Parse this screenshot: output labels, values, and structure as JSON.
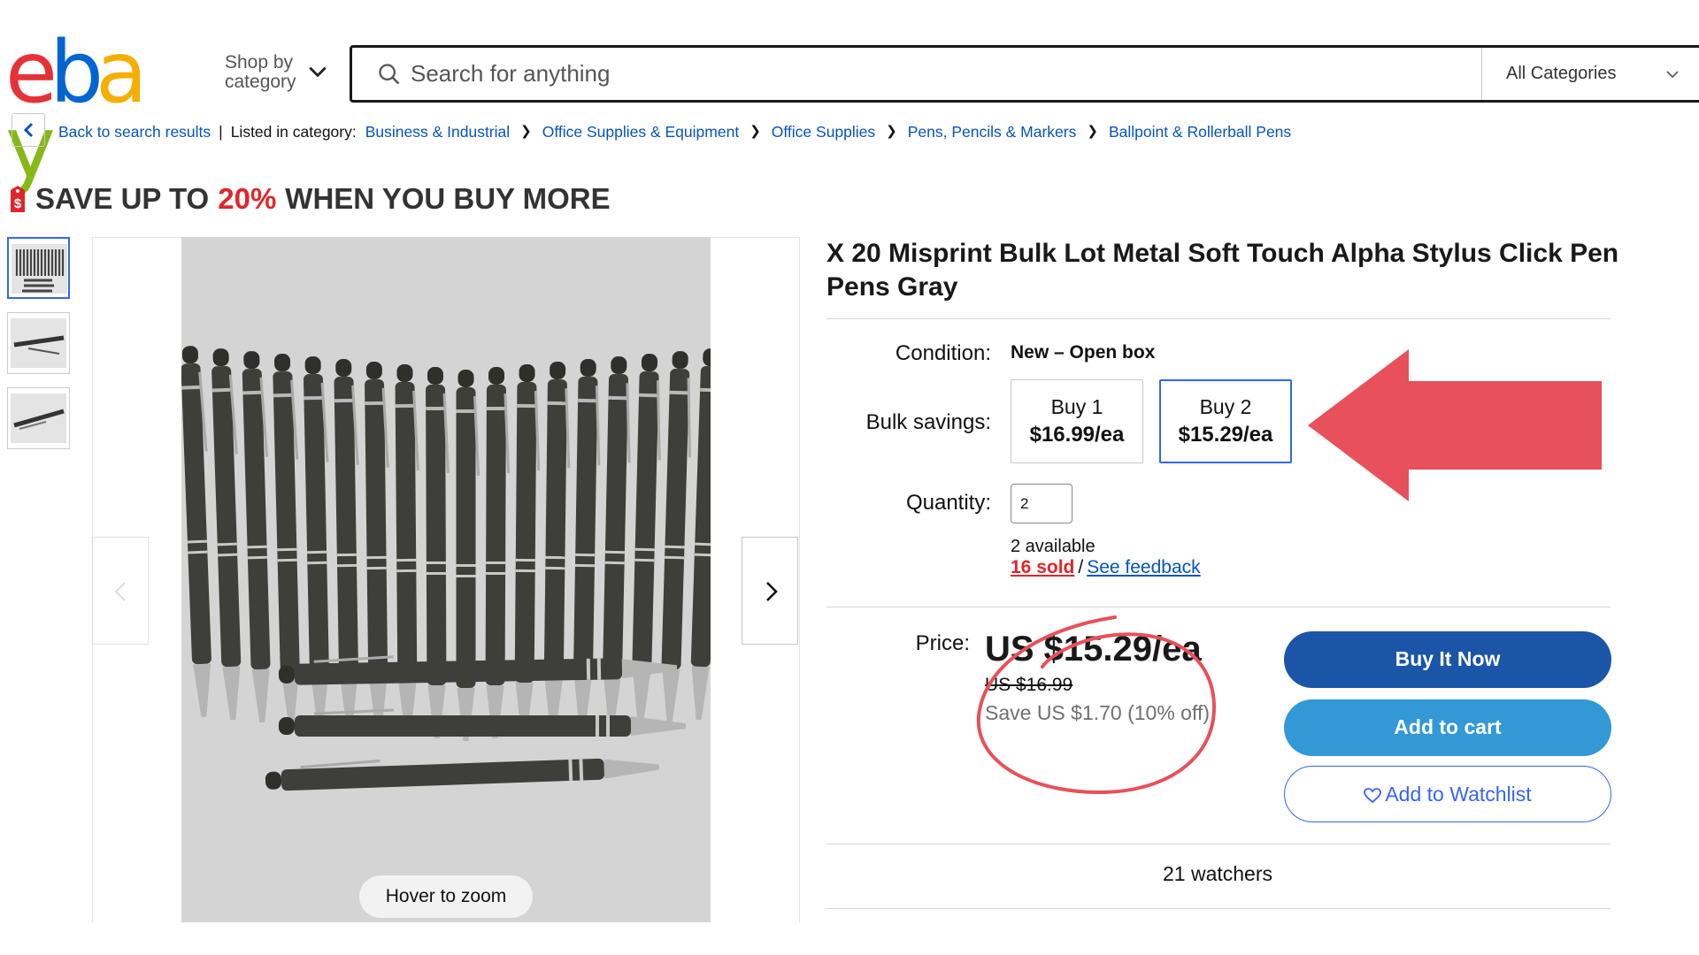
{
  "header": {
    "logo_letters": [
      "e",
      "b",
      "a",
      "y"
    ],
    "shop_by_category_label": "Shop by category",
    "search_placeholder": "Search for anything",
    "category_select": "All Categories"
  },
  "breadcrumb": {
    "back_label": "Back to search results",
    "listed_label": "Listed in category:",
    "items": [
      "Business & Industrial",
      "Office Supplies & Equipment",
      "Office Supplies",
      "Pens, Pencils & Markers",
      "Ballpoint & Rollerball Pens"
    ]
  },
  "promo": {
    "prefix": "SAVE UP TO",
    "percent": "20%",
    "suffix": "WHEN YOU BUY MORE"
  },
  "gallery": {
    "thumbnail_count": 3,
    "zoom_hint": "Hover to zoom"
  },
  "listing": {
    "title": "X 20 Misprint Bulk Lot Metal Soft Touch Alpha Stylus Click Pen Pens Gray",
    "condition_label": "Condition:",
    "condition_value": "New – Open box",
    "bulk_label": "Bulk savings:",
    "bulk_options": [
      {
        "qty": "Buy 1",
        "price": "$16.99/ea"
      },
      {
        "qty": "Buy 2",
        "price": "$15.29/ea"
      }
    ],
    "quantity_label": "Quantity:",
    "quantity_value": "2",
    "available": "2 available",
    "sold": "16 sold",
    "feedback_link": "See feedback",
    "price_label": "Price:",
    "price": "US $15.29/ea",
    "original_price": "US $16.99",
    "savings": "Save US $1.70 (10% off)",
    "buy_now": "Buy It Now",
    "add_to_cart": "Add to cart",
    "watchlist": "Add to Watchlist",
    "watchers": "21 watchers"
  },
  "colors": {
    "brand_blue": "#3665f3",
    "buy_now_bg": "#1b55a8",
    "cart_bg": "#3298d6",
    "annotation_red": "#e8505b",
    "sale_red": "#e0262b"
  }
}
